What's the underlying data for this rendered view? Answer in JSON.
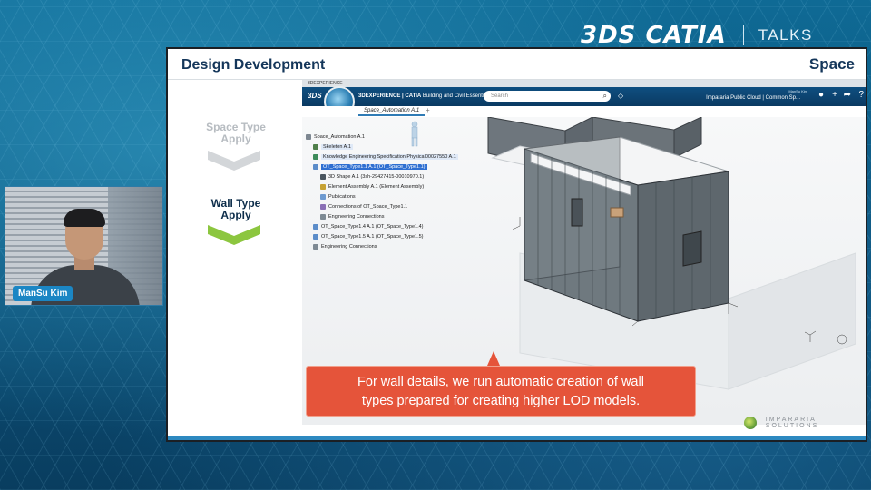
{
  "brand": {
    "logo": "3DS CATIA",
    "talks": "TALKS"
  },
  "speaker": {
    "name": "ManSu Kim"
  },
  "slide": {
    "title": "Design Development",
    "label": "Space",
    "steps": [
      {
        "line1": "Space Type",
        "line2": "Apply",
        "state": "inactive"
      },
      {
        "line1": "Wall Type",
        "line2": "Apply",
        "state": "active"
      }
    ]
  },
  "app": {
    "titlebar": "3DEXPERIENCE",
    "brand_bold": "3DEXPERIENCE | CATIA",
    "brand_rest": "Building and Civil Essential",
    "search_placeholder": "Search",
    "user": "ManSu Kim",
    "tenant": "Impararia Public Cloud | Common Sp...",
    "tab": "Space_Automation A.1",
    "tree": [
      {
        "text": "Space_Automation A.1",
        "style": ""
      },
      {
        "text": "Skeleton A.1",
        "style": "hl"
      },
      {
        "text": "Knowledge Engineering Specification Physical00027550 A.1",
        "style": "hl"
      },
      {
        "text": "OT_Space_Type1.1 A.1 (OT_Space_Type1.1)",
        "style": "sel"
      },
      {
        "text": "3D Shape A.1 (3sh-29427415-00010970.1)",
        "style": ""
      },
      {
        "text": "Element Assembly A.1 (Element Assembly)",
        "style": ""
      },
      {
        "text": "Publications",
        "style": ""
      },
      {
        "text": "Connections of OT_Space_Type1.1",
        "style": ""
      },
      {
        "text": "Engineering Connections",
        "style": ""
      },
      {
        "text": "OT_Space_Type1.4 A.1 (OT_Space_Type1.4)",
        "style": ""
      },
      {
        "text": "OT_Space_Type1.5 A.1 (OT_Space_Type1.5)",
        "style": ""
      },
      {
        "text": "Engineering Connections",
        "style": ""
      }
    ]
  },
  "caption": {
    "line1": "For wall details, we run automatic creation of wall",
    "line2": "types prepared for creating higher LOD models."
  },
  "footer": {
    "company": "IMPARARIA SOLUTIONS"
  },
  "colors": {
    "accent_green": "#8cc63f",
    "caption_bg": "#e5543a",
    "app_bar": "#0f4f80",
    "selection": "#2f6fd1"
  }
}
